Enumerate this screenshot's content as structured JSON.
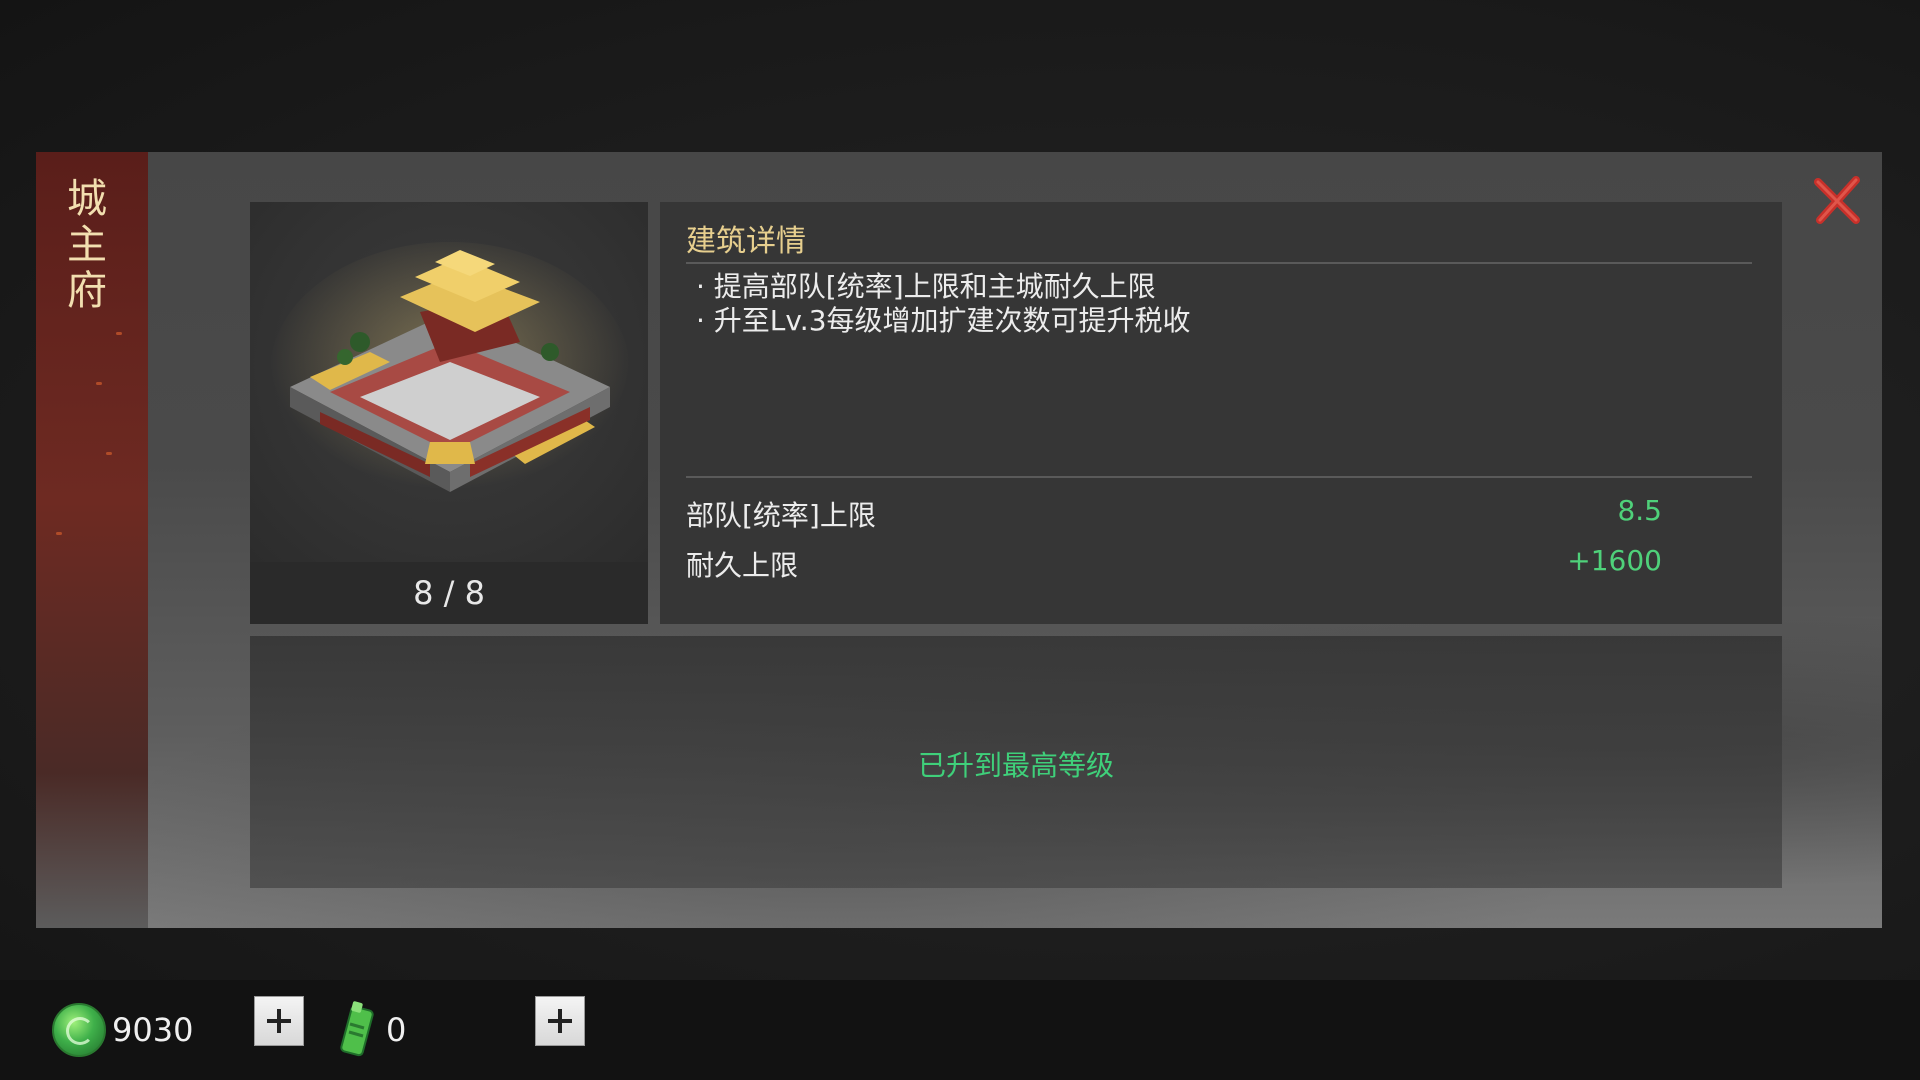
{
  "building": {
    "name_chars": [
      "城",
      "主",
      "府"
    ],
    "level_text": "8 / 8"
  },
  "details": {
    "title": "建筑详情",
    "desc_lines": [
      "· 提高部队[统率]上限和主城耐久上限",
      "· 升至Lv.3每级增加扩建次数可提升税收"
    ],
    "stats": [
      {
        "label": "部队[统率]上限",
        "value": "8.5"
      },
      {
        "label": "耐久上限",
        "value": "+1600"
      }
    ]
  },
  "upgrade": {
    "status": "已升到最高等级"
  },
  "resources": [
    {
      "icon": "jade-coin-icon",
      "value": "9030"
    },
    {
      "icon": "green-token-icon",
      "value": "0"
    }
  ],
  "colors": {
    "accent_gold": "#e7cf8e",
    "stat_green": "#4fd17a",
    "close_red": "#c8302a"
  }
}
